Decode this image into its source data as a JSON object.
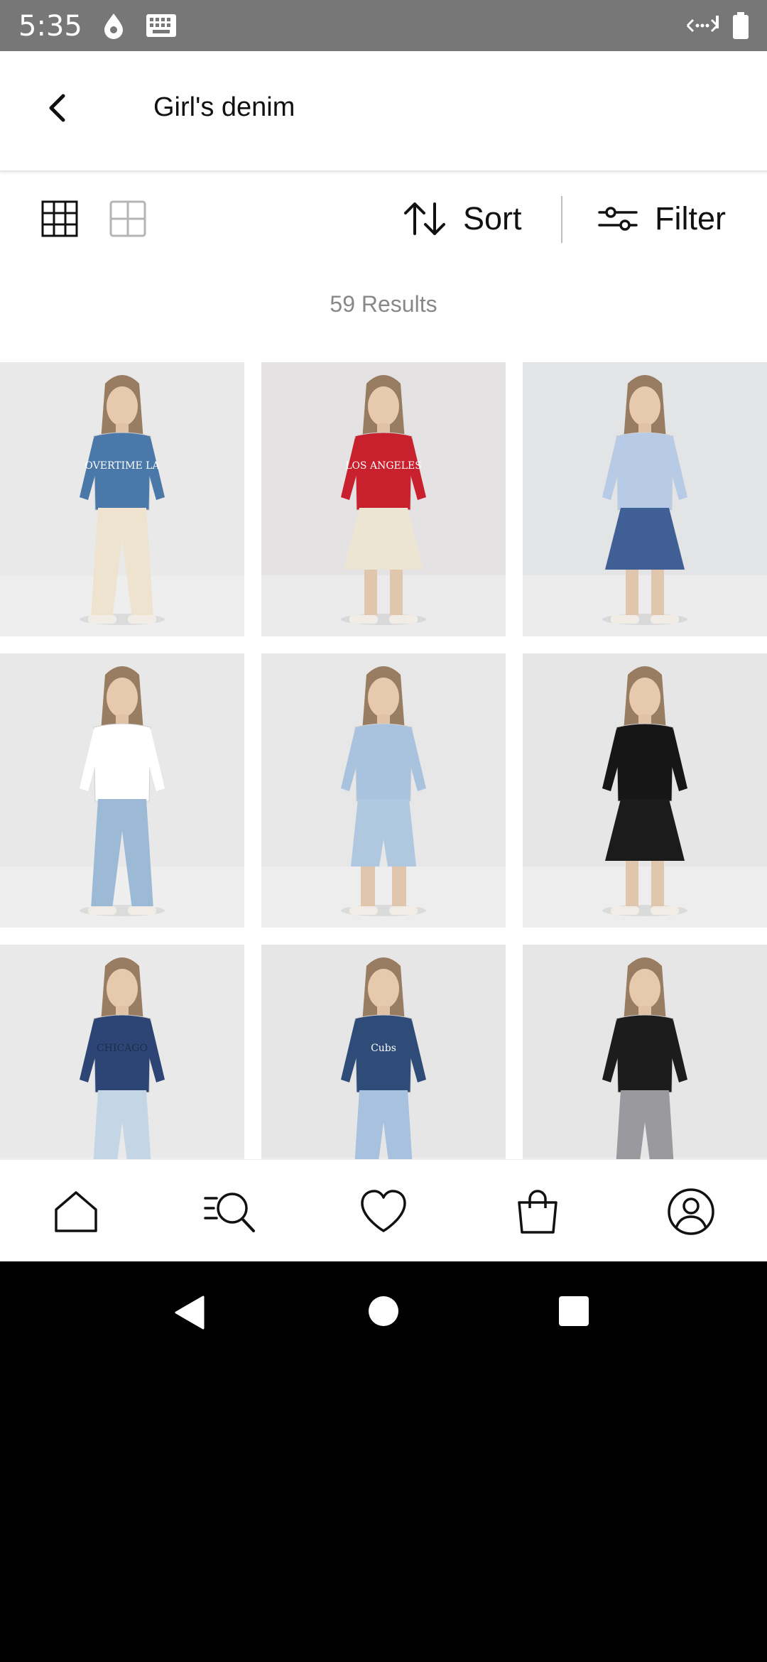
{
  "status_bar": {
    "time": "5:35"
  },
  "header": {
    "title": "Girl's denim"
  },
  "toolbar": {
    "sort_label": "Sort",
    "filter_label": "Filter"
  },
  "results": {
    "text": "59 Results"
  },
  "products": [
    {
      "top_color": "#4a78a8",
      "bottom_color": "#ede3cf",
      "bottom_type": "trousers",
      "bg": "#e9e9e9"
    },
    {
      "top_color": "#c8202c",
      "bottom_color": "#ede5d3",
      "bottom_type": "skirt",
      "bg": "#e4e2e3"
    },
    {
      "top_color": "#b8cbe6",
      "bottom_color": "#3f5f95",
      "bottom_type": "skirt",
      "bg": "#e3e4e6"
    },
    {
      "top_color": "#ffffff",
      "bottom_color": "#9cbad6",
      "bottom_type": "trousers",
      "bg": "#e8e8e8"
    },
    {
      "top_color": "#a9c3de",
      "bottom_color": "#b0c8df",
      "bottom_type": "shorts",
      "bg": "#e7e7e7"
    },
    {
      "top_color": "#161616",
      "bottom_color": "#1b1b1b",
      "bottom_type": "skirt",
      "bg": "#e6e6e6"
    },
    {
      "top_color": "#2d4575",
      "bottom_color": "#c4d6e6",
      "bottom_type": "trousers",
      "bg": "#e9e9e9"
    },
    {
      "top_color": "#2f4b78",
      "bottom_color": "#a7c1de",
      "bottom_type": "trousers",
      "bg": "#e6e6e6"
    },
    {
      "top_color": "#1c1c1c",
      "bottom_color": "#9a9a9e",
      "bottom_type": "trousers",
      "bg": "#e6e6e6"
    }
  ],
  "product_print": {
    "tile1": "OVERTIME LA",
    "tile2": "LOS ANGELES",
    "tile7": "CHICAGO",
    "tile8": "Cubs"
  },
  "nav": {
    "items": [
      "home-icon",
      "search-icon",
      "heart-icon",
      "bag-icon",
      "account-icon"
    ]
  },
  "colors": {
    "status_bar": "#777777",
    "accent": "#111111",
    "muted": "#888888"
  }
}
